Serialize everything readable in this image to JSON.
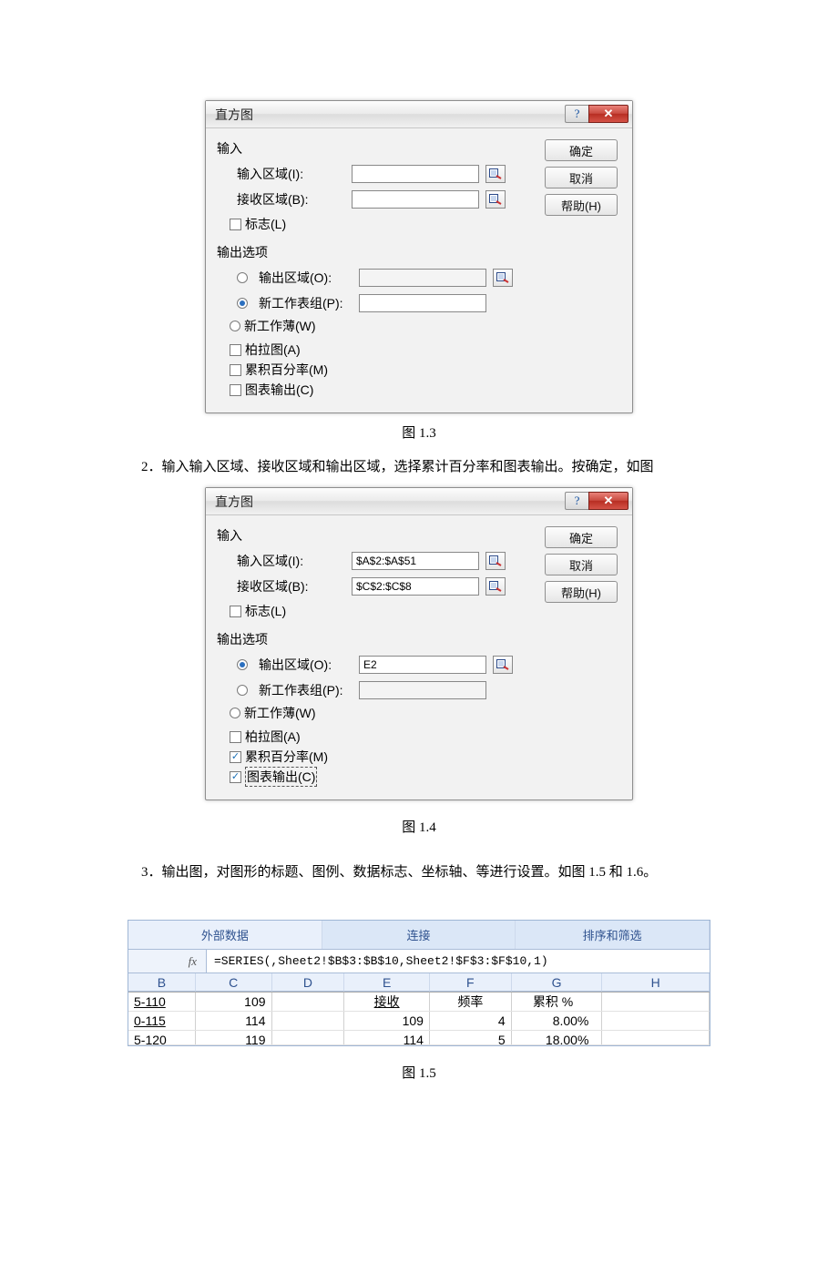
{
  "dlg1": {
    "title": "直方图",
    "help_char": "?",
    "close_char": "✕",
    "input_group": "输入",
    "input_range_lbl": "输入区域(I):",
    "bin_range_lbl": "接收区域(B):",
    "labels_chk": "标志(L)",
    "output_group": "输出选项",
    "out_range": "输出区域(O):",
    "new_sheet": "新工作表组(P):",
    "new_book": "新工作薄(W)",
    "pareto": "柏拉图(A)",
    "cum": "累积百分率(M)",
    "chart_out": "图表输出(C)",
    "ok": "确定",
    "cancel": "取消",
    "helpbtn": "帮助(H)",
    "input_range_val": "",
    "bin_range_val": "",
    "out_range_val": "",
    "new_sheet_val": ""
  },
  "caption1": "图 1.3",
  "step2": "2．输入输入区域、接收区域和输出区域，选择累计百分率和图表输出。按确定，如图",
  "dlg2": {
    "title": "直方图",
    "input_range_val": "$A$2:$A$51",
    "bin_range_val": "$C$2:$C$8",
    "out_range_val": "E2",
    "new_sheet_val": ""
  },
  "caption2": "图 1.4",
  "step3": "3．输出图，对图形的标题、图例、数据标志、坐标轴、等进行设置。如图 1.5 和 1.6。",
  "excel": {
    "tab1": "外部数据",
    "tab2": "连接",
    "tab3": "排序和筛选",
    "fx": "fx",
    "formula": "=SERIES(,Sheet2!$B$3:$B$10,Sheet2!$F$3:$F$10,1)",
    "cols": [
      "B",
      "C",
      "D",
      "E",
      "F",
      "G",
      "H"
    ],
    "head": {
      "B": "5-110",
      "C": "109",
      "E": "接收",
      "F": "频率",
      "G": "累积 %"
    },
    "r1": {
      "B": "0-115",
      "C": "114",
      "E": "109",
      "F": "4",
      "G": "8.00%"
    },
    "r2": {
      "B": "5-120",
      "C": "119",
      "E": "114",
      "F": "5",
      "G": "18.00%"
    }
  },
  "caption3": "图 1.5"
}
